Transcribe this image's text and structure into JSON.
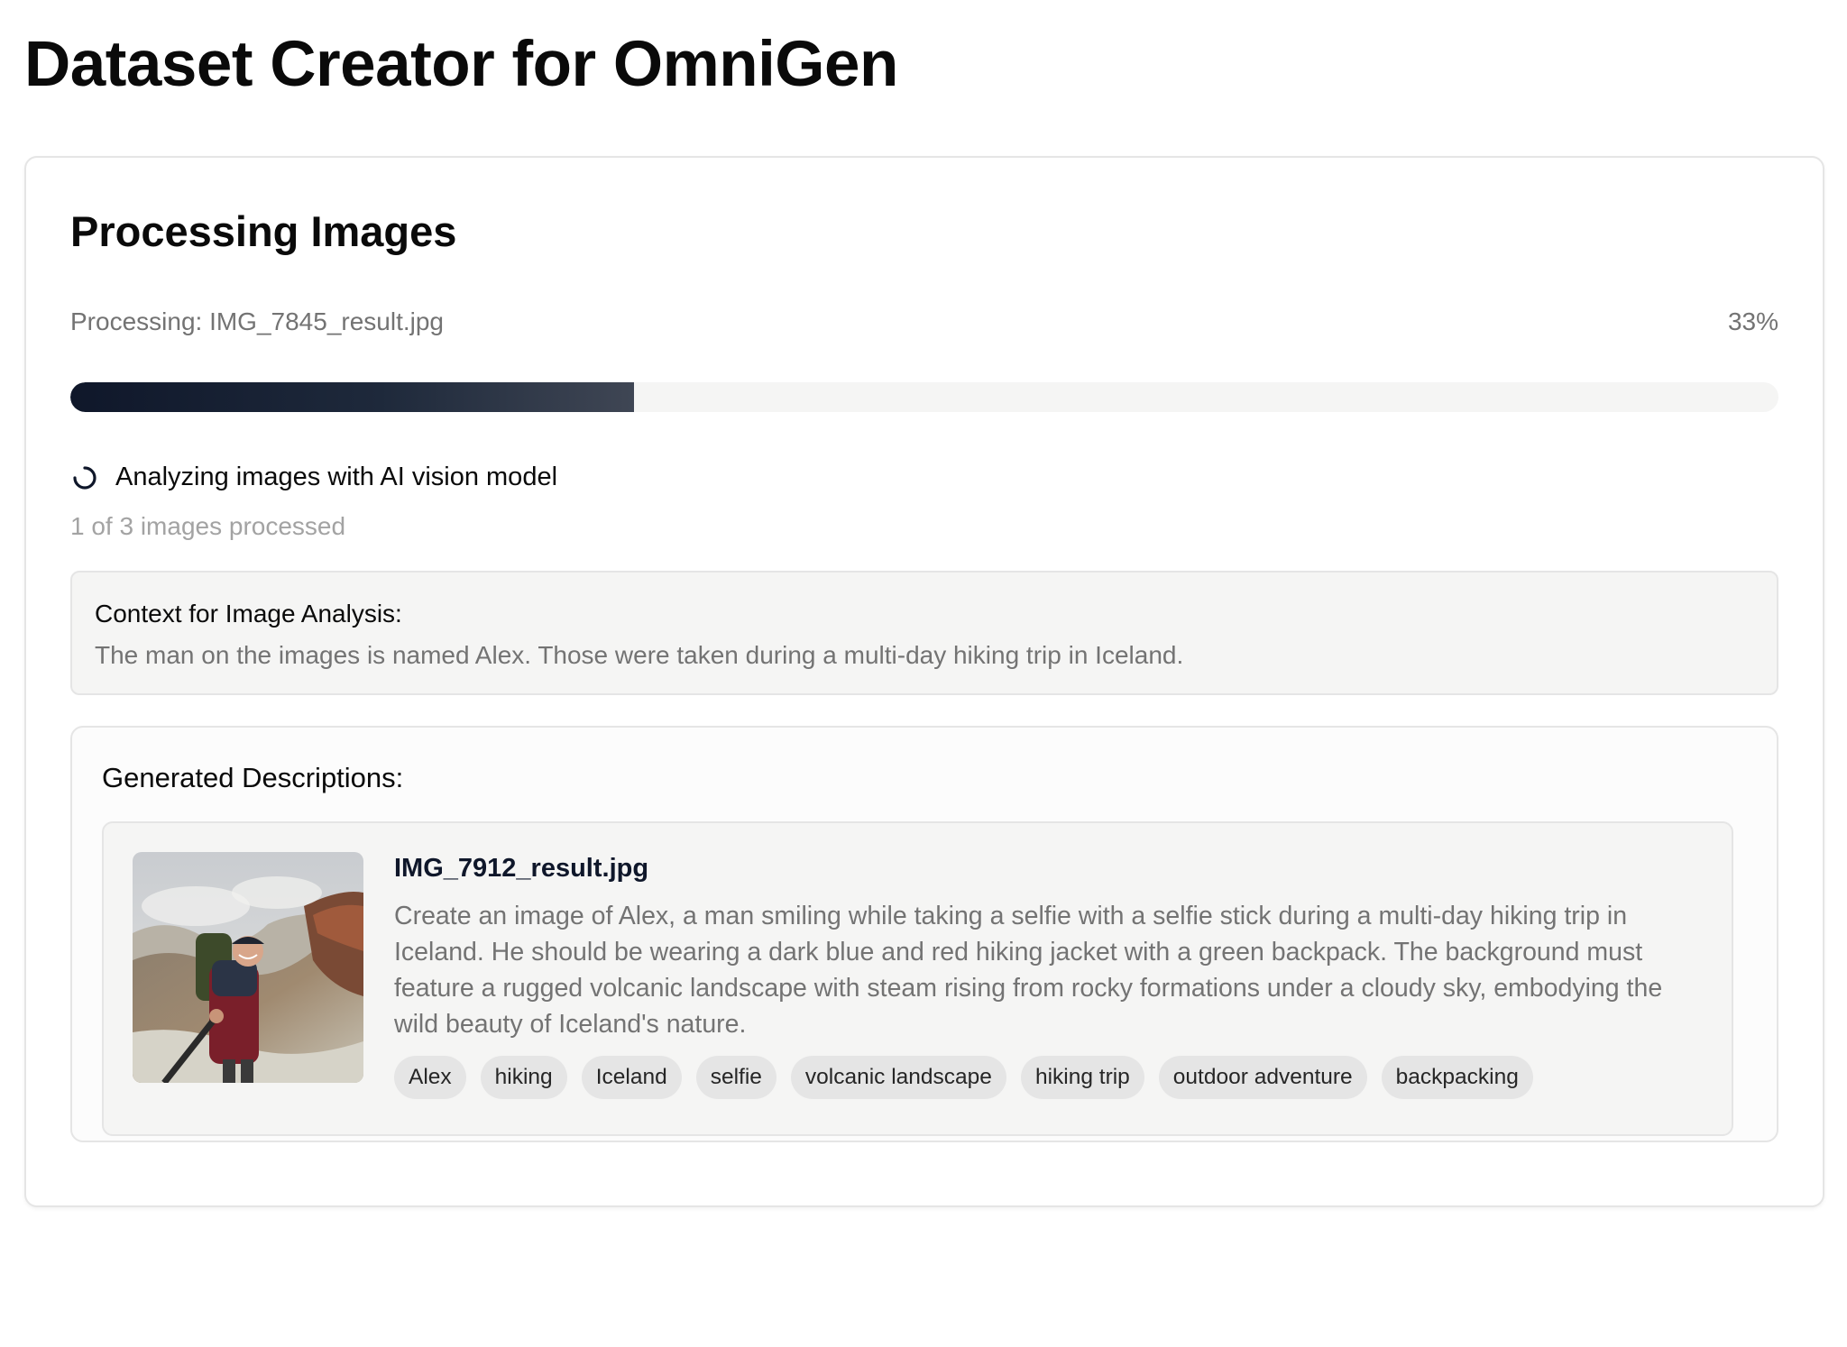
{
  "header": {
    "title": "Dataset Creator for OmniGen"
  },
  "processing": {
    "title": "Processing Images",
    "current_file_text": "Processing: IMG_7845_result.jpg",
    "percent_label": "33%",
    "progress_fraction": 0.33,
    "status_text": "Analyzing images with AI vision model",
    "count_text": "1 of 3 images processed"
  },
  "context": {
    "label": "Context for Image Analysis:",
    "text": "The man on the images is named Alex. Those were taken during a multi-day hiking trip in Iceland."
  },
  "descriptions": {
    "title": "Generated Descriptions:",
    "items": [
      {
        "file_name": "IMG_7912_result.jpg",
        "description": "Create an image of Alex, a man smiling while taking a selfie with a selfie stick during a multi-day hiking trip in Iceland. He should be wearing a dark blue and red hiking jacket with a green backpack. The background must feature a rugged volcanic landscape with steam rising from rocky formations under a cloudy sky, embodying the wild beauty of Iceland's nature.",
        "tags": [
          "Alex",
          "hiking",
          "Iceland",
          "selfie",
          "volcanic landscape",
          "hiking trip",
          "outdoor adventure",
          "backpacking"
        ]
      }
    ]
  },
  "icons": {
    "spinner": "loading-spinner-icon",
    "thumbnail": "photo-thumbnail"
  },
  "colors": {
    "progress_fill": "#0f172a",
    "progress_track": "#f5f5f4",
    "muted_text": "#737373",
    "tag_bg": "#e5e5e5"
  }
}
